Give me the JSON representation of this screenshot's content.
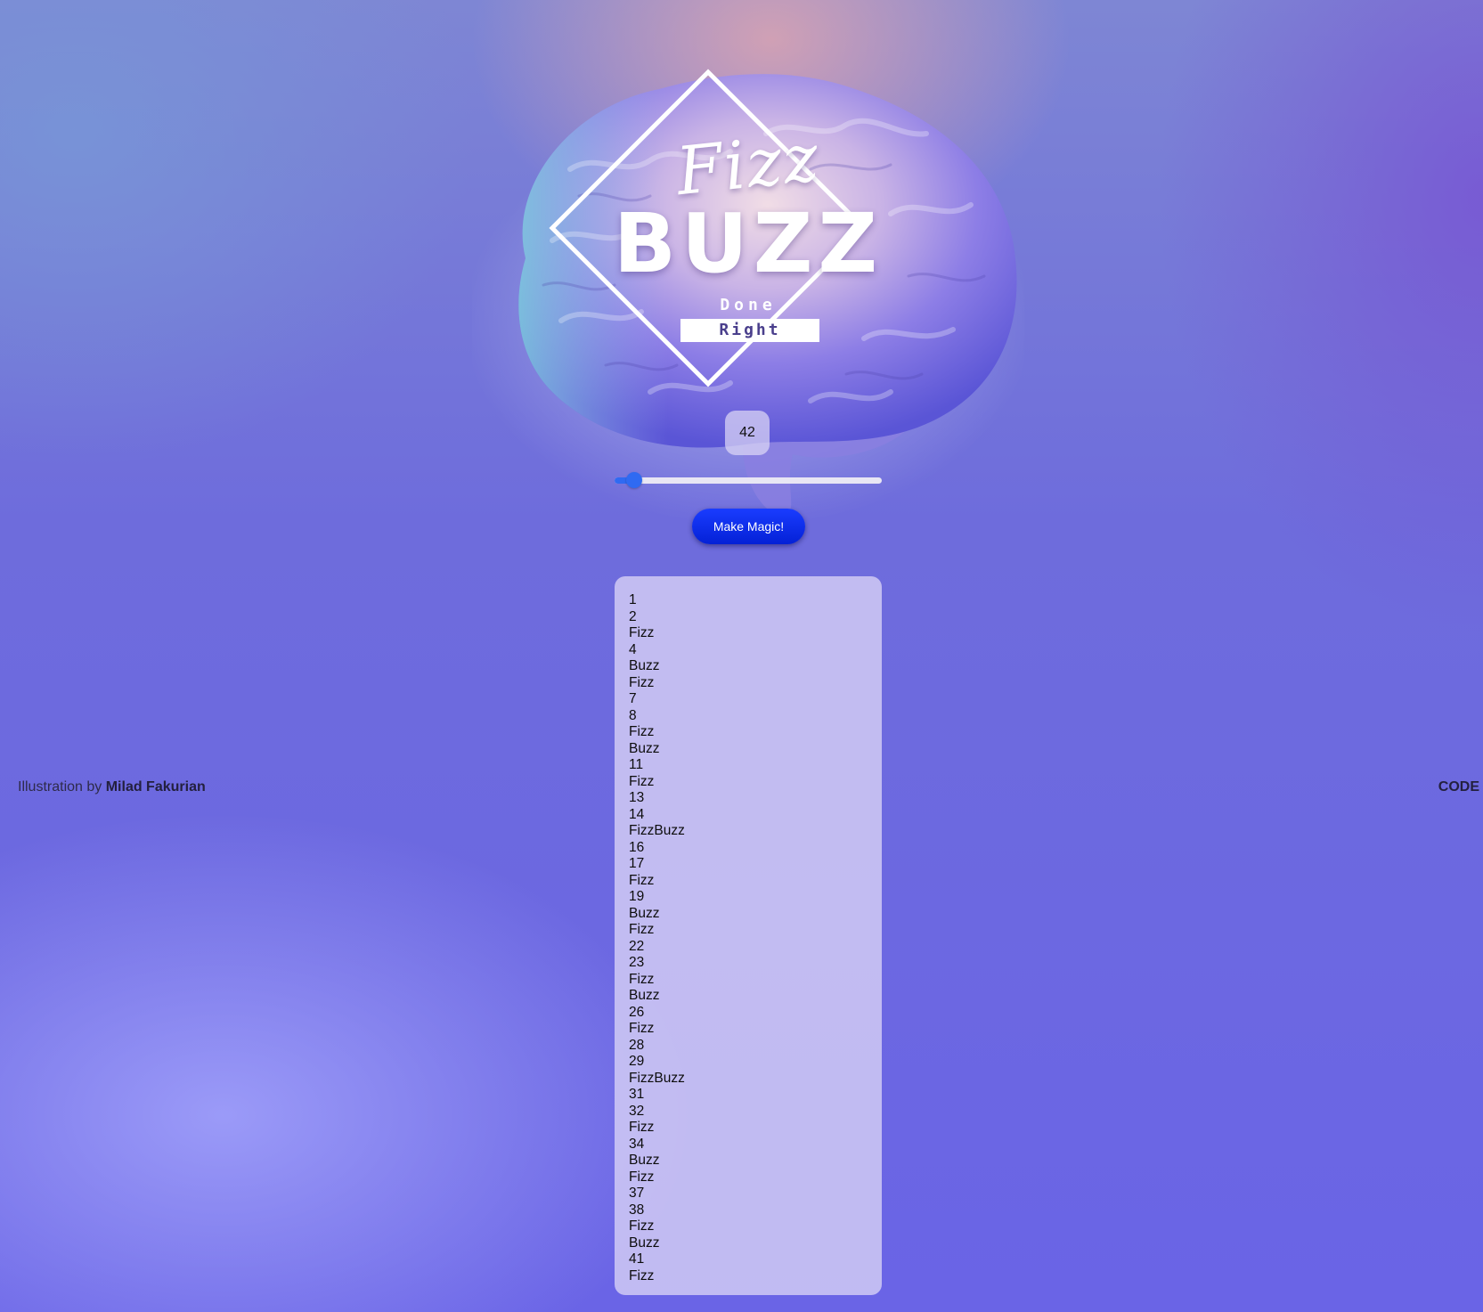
{
  "logo": {
    "line1": "Fizz",
    "line2": "BUZZ",
    "line3": "Done",
    "line4": "Right"
  },
  "counter": {
    "value": "42"
  },
  "slider": {
    "value": 42,
    "max": 400
  },
  "button": {
    "label": "Make Magic!"
  },
  "output": {
    "items": [
      "1",
      "2",
      "Fizz",
      "4",
      "Buzz",
      "Fizz",
      "7",
      "8",
      "Fizz",
      "Buzz",
      "11",
      "Fizz",
      "13",
      "14",
      "FizzBuzz",
      "16",
      "17",
      "Fizz",
      "19",
      "Buzz",
      "Fizz",
      "22",
      "23",
      "Fizz",
      "Buzz",
      "26",
      "Fizz",
      "28",
      "29",
      "FizzBuzz",
      "31",
      "32",
      "Fizz",
      "34",
      "Buzz",
      "Fizz",
      "37",
      "38",
      "Fizz",
      "Buzz",
      "41",
      "Fizz"
    ]
  },
  "credit": {
    "prefix": "Illustration by",
    "author": "Milad Fakurian"
  },
  "code_link": {
    "label": "CODE"
  },
  "colors": {
    "accent": "#2f6af2",
    "button": "#0a2ae8"
  }
}
